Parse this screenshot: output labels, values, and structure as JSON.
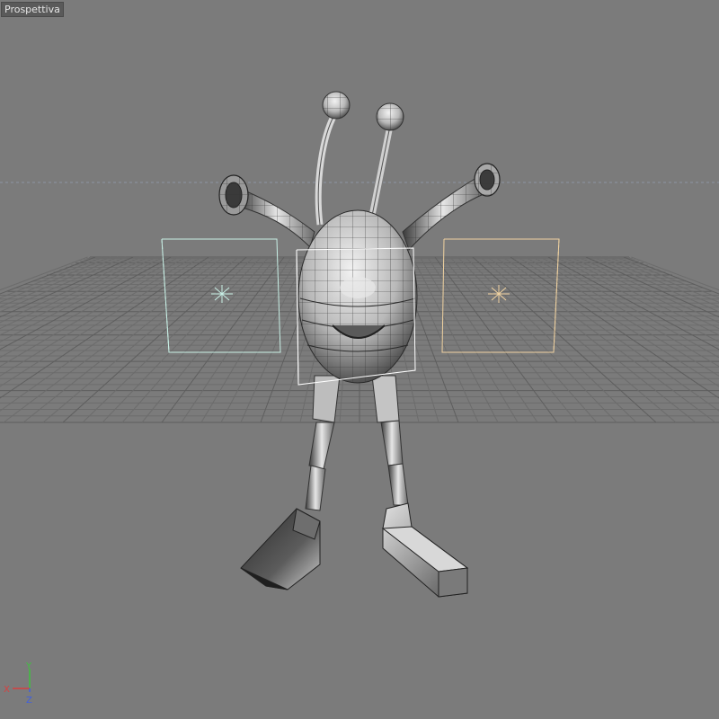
{
  "viewport": {
    "view_name": "Prospettiva"
  },
  "axes": {
    "x_label": "X",
    "y_label": "Y",
    "z_label": "Z"
  },
  "colors": {
    "background": "#7b7b7b",
    "grid": "#6c6c6c",
    "grid_major": "#5e5e5e",
    "horizon": "#8a93a0",
    "light_cool": "#c8f0e6",
    "light_warm": "#f0d2a0",
    "selection": "#ffffff",
    "axis_x": "#d84040",
    "axis_y": "#40c040",
    "axis_z": "#4060e0"
  }
}
